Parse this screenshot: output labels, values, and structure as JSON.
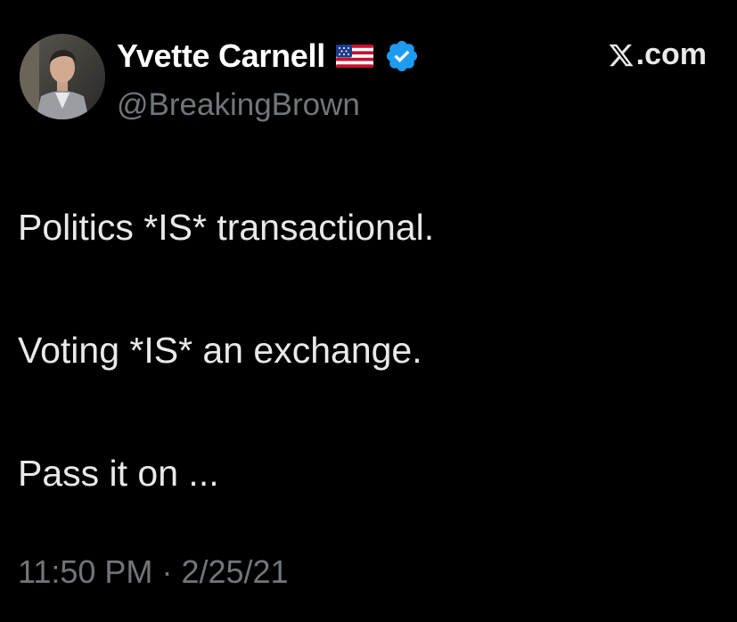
{
  "author": {
    "display_name": "Yvette Carnell",
    "handle": "@BreakingBrown",
    "flag_icon": "us-flag-icon",
    "verified_icon": "verified-badge-icon"
  },
  "brand": {
    "logo_icon": "x-logo-icon",
    "text": ".com"
  },
  "tweet": {
    "lines": [
      "Politics *IS* transactional.",
      "Voting *IS* an exchange.",
      "Pass it on ..."
    ],
    "time": "11:50 PM",
    "separator": "·",
    "date": "2/25/21"
  },
  "colors": {
    "background": "#000000",
    "text_primary": "#e7e9ea",
    "text_secondary": "#71767b",
    "verified_blue": "#1d9bf0"
  }
}
